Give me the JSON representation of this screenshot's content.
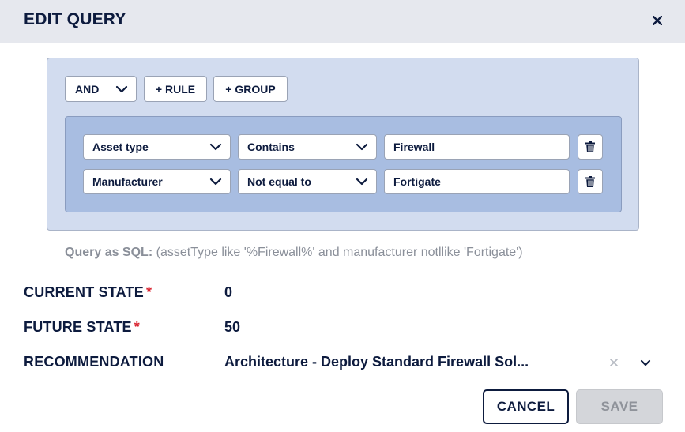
{
  "dialog": {
    "title": "EDIT QUERY"
  },
  "query_builder": {
    "combinator": "AND",
    "add_rule_label": "+ RULE",
    "add_group_label": "+ GROUP",
    "rules": [
      {
        "field": "Asset type",
        "operator": "Contains",
        "value": "Firewall"
      },
      {
        "field": "Manufacturer",
        "operator": "Not equal to",
        "value": "Fortigate"
      }
    ]
  },
  "sql": {
    "label": "Query as SQL:",
    "text": "(assetType like '%Firewall%' and manufacturer notllike 'Fortigate')"
  },
  "form": {
    "current_state": {
      "label": "CURRENT STATE",
      "required_mark": "*",
      "value": "0"
    },
    "future_state": {
      "label": "FUTURE STATE",
      "required_mark": "*",
      "value": "50"
    },
    "recommendation": {
      "label": "RECOMMENDATION",
      "value": "Architecture - Deploy Standard Firewall Sol..."
    }
  },
  "actions": {
    "cancel_label": "CANCEL",
    "save_label": "SAVE"
  },
  "icons": {
    "close": "close-icon",
    "chevron": "chevron-down-icon",
    "delete": "trash-icon",
    "clear": "clear-icon"
  },
  "colors": {
    "text_primary": "#0d1b3e",
    "builder_bg": "#d2dcef",
    "group_bg": "#a8bde1",
    "required": "#d9232f",
    "disabled_bg": "#d4d6da"
  }
}
